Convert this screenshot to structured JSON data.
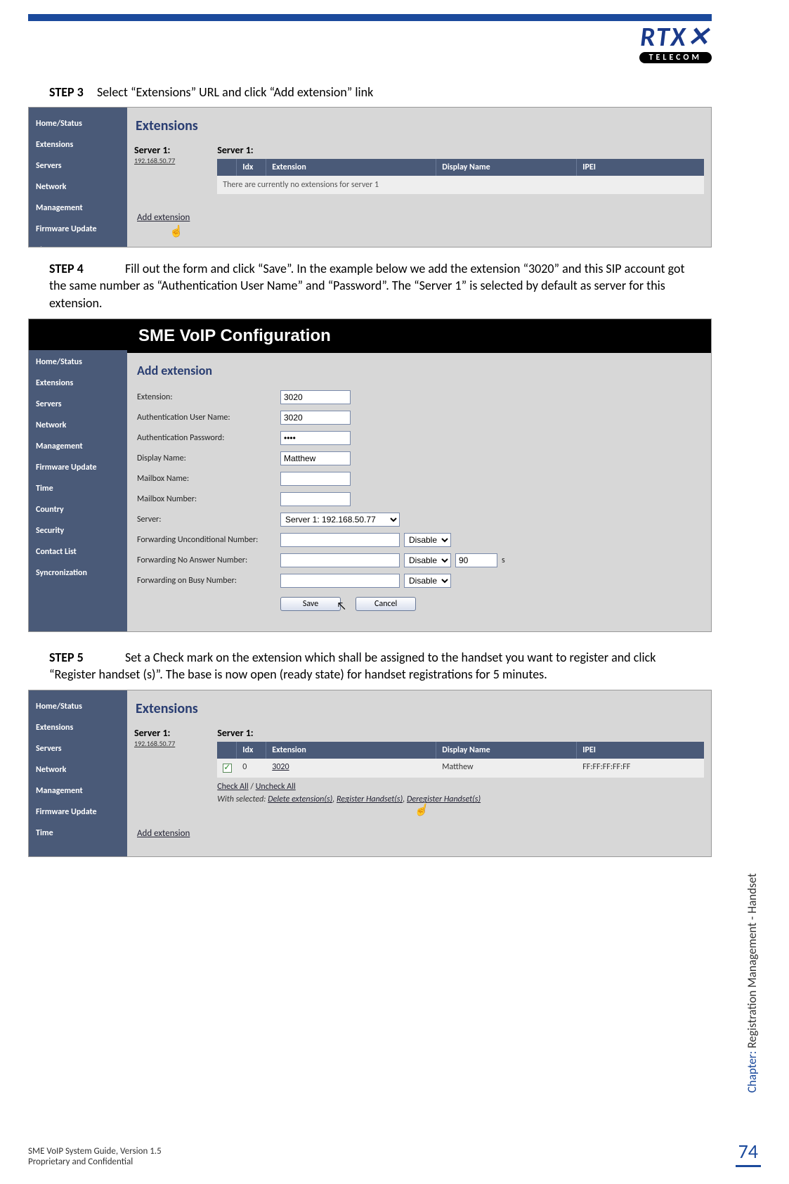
{
  "logo": {
    "brand": "RTX",
    "sub": "TELECOM"
  },
  "step3": {
    "label": "STEP 3",
    "text": "Select “Extensions” URL and click “Add extension” link"
  },
  "step4": {
    "label": "STEP 4",
    "text": "Fill out the form and click “Save”. In the example below we add the extension “3020” and this SIP account got the same number as “Authentication User Name” and “Password”. The “Server 1” is selected by default  as server for this extension."
  },
  "step5": {
    "label": "STEP 5",
    "text": "Set a Check mark on the extension which shall be assigned to the handset you want to register and click “Register handset (s)”. The base is now open (ready state) for handset registrations for 5 minutes."
  },
  "sidebar_short": [
    "Home/Status",
    "Extensions",
    "Servers",
    "Network",
    "Management",
    "Firmware Update",
    "Time"
  ],
  "sidebar_long": [
    "Home/Status",
    "Extensions",
    "Servers",
    "Network",
    "Management",
    "Firmware Update",
    "Time",
    "Country",
    "Security",
    "Contact List",
    "Syncronization"
  ],
  "shot1": {
    "heading": "Extensions",
    "server_label": "Server 1:",
    "server_ip": "192.168.50.77",
    "tbl_server_title": "Server 1:",
    "cols": {
      "idx": "Idx",
      "ext": "Extension",
      "dn": "Display Name",
      "ipei": "IPEI"
    },
    "empty_msg": "There are currently no extensions for server 1",
    "add_link": "Add extension"
  },
  "shot2": {
    "title": "SME VoIP Configuration",
    "heading": "Add extension",
    "labels": {
      "ext": "Extension:",
      "auth_user": "Authentication User Name:",
      "auth_pass": "Authentication Password:",
      "disp": "Display Name:",
      "mbx_name": "Mailbox Name:",
      "mbx_num": "Mailbox Number:",
      "server": "Server:",
      "fwd_uncond": "Forwarding Unconditional Number:",
      "fwd_noans": "Forwarding No Answer Number:",
      "fwd_busy": "Forwarding on Busy Number:"
    },
    "values": {
      "ext": "3020",
      "auth_user": "3020",
      "auth_pass": "••••",
      "disp": "Matthew",
      "mbx_name": "",
      "mbx_num": "",
      "server": "Server 1: 192.168.50.77",
      "fwd_uncond": "",
      "fwd_noans_timeout": "90",
      "fwd_busy": "",
      "disable": "Disable",
      "seconds": "s"
    },
    "buttons": {
      "save": "Save",
      "cancel": "Cancel"
    }
  },
  "shot3": {
    "heading": "Extensions",
    "server_label": "Server 1:",
    "server_ip": "192.168.50.77",
    "tbl_server_title": "Server 1:",
    "cols": {
      "idx": "Idx",
      "ext": "Extension",
      "dn": "Display Name",
      "ipei": "IPEI"
    },
    "row": {
      "idx": "0",
      "ext": "3020",
      "dn": "Matthew",
      "ipei": "FF:FF:FF:FF:FF"
    },
    "check_all": "Check All",
    "uncheck_all": "Uncheck All",
    "with_selected": "With selected:",
    "del": "Delete extension(s)",
    "reg": "Register Handset(s)",
    "dereg": "Deregister Handset(s)",
    "add_link": "Add extension"
  },
  "footer": {
    "line1": "SME VoIP System Guide, Version 1.5",
    "line2": "Proprietary and Confidential",
    "page": "74",
    "chapter_label": "Chapter:",
    "chapter_title": " Registration Management - Handset"
  }
}
